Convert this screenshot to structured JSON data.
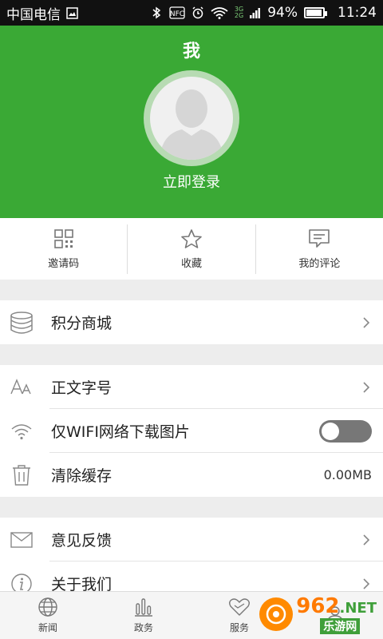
{
  "status_bar": {
    "carrier": "中国电信",
    "battery_percent": "94%",
    "battery_level": 0.94,
    "time": "11:24",
    "network_label_top": "3G",
    "network_label_bottom": "2G"
  },
  "header": {
    "title": "我",
    "login_label": "立即登录",
    "color": "#3aa935"
  },
  "quick_actions": [
    {
      "label": "邀请码",
      "icon": "qr-code-icon"
    },
    {
      "label": "收藏",
      "icon": "star-icon"
    },
    {
      "label": "我的评论",
      "icon": "comment-icon"
    }
  ],
  "sections": {
    "points_mall": {
      "label": "积分商城",
      "icon": "database-icon"
    },
    "font_size": {
      "label": "正文字号",
      "icon": "font-size-icon"
    },
    "wifi_only": {
      "label": "仅WIFI网络下载图片",
      "icon": "wifi-icon",
      "toggle_on": false
    },
    "clear_cache": {
      "label": "清除缓存",
      "icon": "trash-icon",
      "value": "0.00MB"
    },
    "feedback": {
      "label": "意见反馈",
      "icon": "mail-icon"
    },
    "about": {
      "label": "关于我们",
      "icon": "info-icon"
    }
  },
  "tabs": [
    {
      "label": "新闻",
      "icon": "globe-icon"
    },
    {
      "label": "政务",
      "icon": "bar-chart-icon"
    },
    {
      "label": "服务",
      "icon": "heart-icon"
    },
    {
      "label": "",
      "icon": "user-icon"
    }
  ],
  "watermark": {
    "number": "962",
    "suffix": ".NET",
    "caption": "乐游网"
  }
}
